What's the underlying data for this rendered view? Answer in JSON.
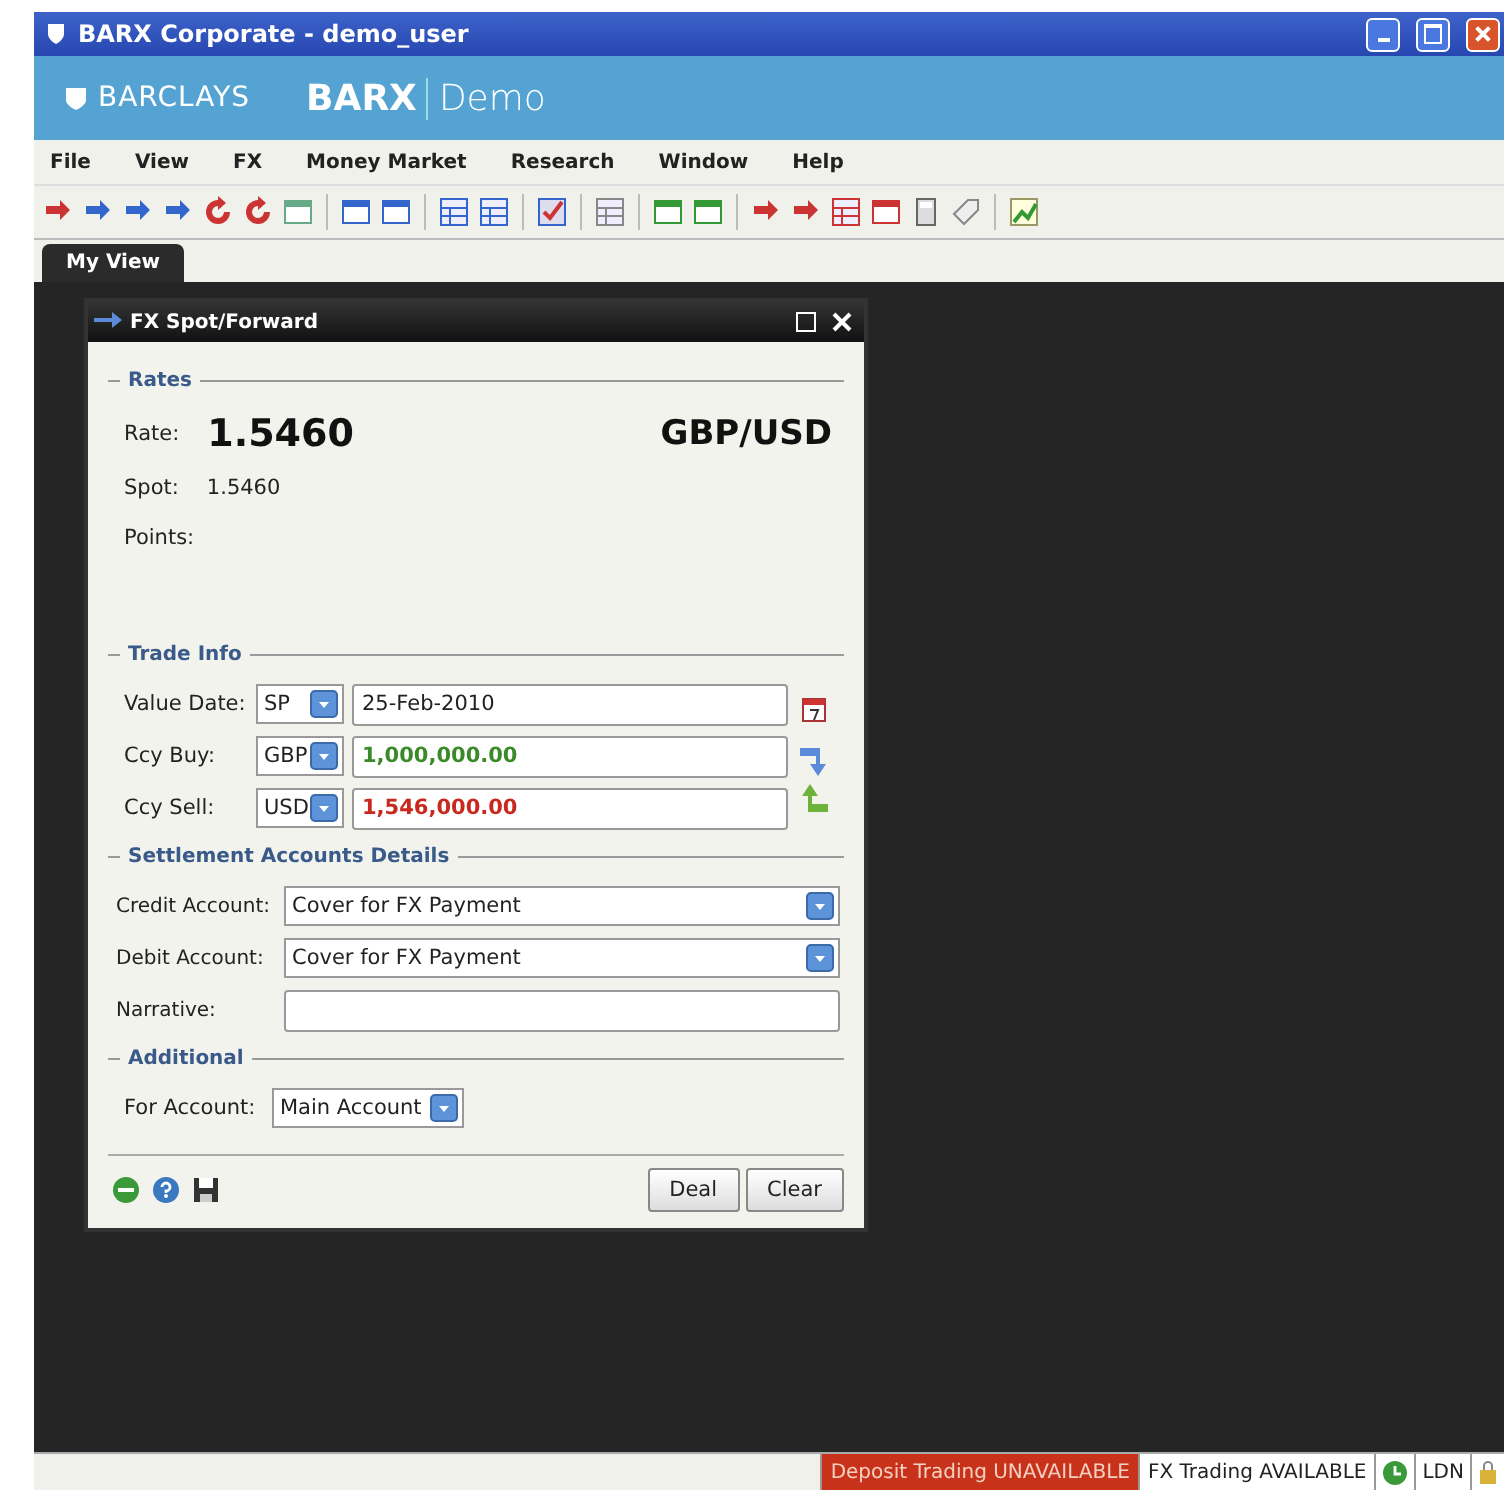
{
  "window": {
    "title": "BARX Corporate - demo_user"
  },
  "brand": {
    "bank": "BARCLAYS",
    "product": "BARX",
    "edition": "Demo"
  },
  "menu": [
    "File",
    "View",
    "FX",
    "Money Market",
    "Research",
    "Window",
    "Help"
  ],
  "tabs": [
    {
      "label": "My View",
      "selected": true
    }
  ],
  "panel": {
    "title": "FX Spot/Forward",
    "rates": {
      "heading": "Rates",
      "rate_label": "Rate:",
      "rate": "1.5460",
      "pair": "GBP/USD",
      "spot_label": "Spot:",
      "spot": "1.5460",
      "points_label": "Points:"
    },
    "trade_info": {
      "heading": "Trade Info",
      "rows": [
        {
          "label": "Value Date:",
          "code": "SP",
          "value": "25-Feb-2010",
          "kind": "date"
        },
        {
          "label": "Ccy Buy:",
          "code": "GBP",
          "value": "1,000,000.00",
          "kind": "buy"
        },
        {
          "label": "Ccy Sell:",
          "code": "USD",
          "value": "1,546,000.00",
          "kind": "sell"
        }
      ]
    },
    "settlement": {
      "heading": "Settlement Accounts Details",
      "rows": [
        {
          "label": "Credit Account:",
          "value": "Cover for FX Payment",
          "kind": "select"
        },
        {
          "label": "Debit Account:",
          "value": "Cover for FX Payment",
          "kind": "select"
        },
        {
          "label": "Narrative:",
          "kind": "text"
        }
      ]
    },
    "additional": {
      "heading": "Additional",
      "label": "For Account:",
      "value": "Main Account"
    },
    "buttons": [
      "Deal",
      "Clear"
    ]
  },
  "status_bar": {
    "items": [
      {
        "text": "Deposit Trading UNAVAILABLE",
        "available": false
      },
      {
        "text": "FX Trading AVAILABLE",
        "available": true
      }
    ],
    "region": "LDN"
  }
}
